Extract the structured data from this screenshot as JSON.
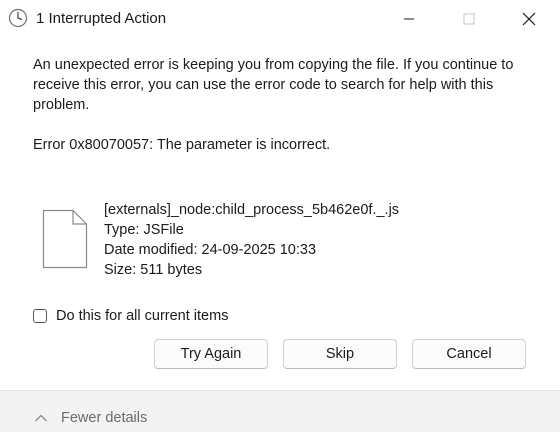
{
  "window": {
    "title": "1 Interrupted Action",
    "icon": "clock-icon"
  },
  "message": {
    "text": "An unexpected error is keeping you from copying the file. If you continue to receive this error, you can use the error code to search for help with this problem.",
    "error": "Error 0x80070057: The parameter is incorrect."
  },
  "file": {
    "icon": "document-icon",
    "name": "[externals]_node:child_process_5b462e0f._.js",
    "type": "Type: JSFile",
    "modified": "Date modified: 24-09-2025 10:33",
    "size": "Size: 511 bytes"
  },
  "checkbox": {
    "label": "Do this for all current items",
    "checked": false
  },
  "buttons": {
    "try_again": "Try Again",
    "skip": "Skip",
    "cancel": "Cancel"
  },
  "footer": {
    "details_label": "Fewer details"
  },
  "colors": {
    "footer_bg": "#f3f3f3",
    "button_bg": "#fbfbfb",
    "text": "#1b1b1b",
    "muted_text": "#6b6b6b"
  }
}
